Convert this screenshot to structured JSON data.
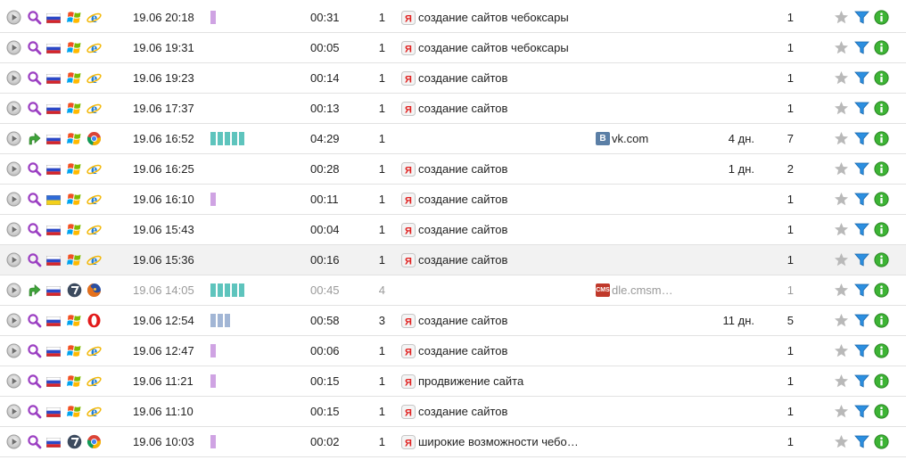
{
  "icons": {
    "play": "play-icon",
    "search_src": "magnifier-icon",
    "link_src": "arrow-link-icon",
    "ru": "flag-ru-icon",
    "ua": "flag-ua-icon",
    "xp": "windows-xp-icon",
    "w7": "windows-7-icon",
    "ie": "ie-icon",
    "chrome": "chrome-icon",
    "firefox": "firefox-icon",
    "opera": "opera-icon",
    "yandex": "yandex-icon",
    "vk": "vk-icon",
    "cms": "cms-icon",
    "star": "star-icon",
    "filter": "filter-icon",
    "info": "info-icon"
  },
  "colors": {
    "bar_violet": "#cfa3e3",
    "bar_teal": "#5ec4bd",
    "bar_blue": "#a2b6d5",
    "yandex_red": "#e0201f"
  },
  "visits": [
    {
      "src": "search",
      "flag": "ru",
      "os": "xp",
      "browser": "ie",
      "time": "19.06 20:18",
      "depth": 1,
      "bar": "violet",
      "duration": "00:31",
      "pageviews": "1",
      "ref": "yandex",
      "keyword": "создание сайтов чебоксары",
      "site": "",
      "days": "",
      "count": "1"
    },
    {
      "src": "search",
      "flag": "ru",
      "os": "xp",
      "browser": "ie",
      "time": "19.06 19:31",
      "depth": 0,
      "bar": "",
      "duration": "00:05",
      "pageviews": "1",
      "ref": "yandex",
      "keyword": "создание сайтов чебоксары",
      "site": "",
      "days": "",
      "count": "1"
    },
    {
      "src": "search",
      "flag": "ru",
      "os": "xp",
      "browser": "ie",
      "time": "19.06 19:23",
      "depth": 0,
      "bar": "",
      "duration": "00:14",
      "pageviews": "1",
      "ref": "yandex",
      "keyword": "создание сайтов",
      "site": "",
      "days": "",
      "count": "1"
    },
    {
      "src": "search",
      "flag": "ru",
      "os": "xp",
      "browser": "ie",
      "time": "19.06 17:37",
      "depth": 0,
      "bar": "",
      "duration": "00:13",
      "pageviews": "1",
      "ref": "yandex",
      "keyword": "создание сайтов",
      "site": "",
      "days": "",
      "count": "1"
    },
    {
      "src": "link",
      "flag": "ru",
      "os": "xp",
      "browser": "chrome",
      "time": "19.06 16:52",
      "depth": 5,
      "bar": "teal",
      "duration": "04:29",
      "pageviews": "1",
      "ref": "",
      "keyword": "",
      "site": "vk.com",
      "site_logo": "vk",
      "site_logo_text": "В",
      "days": "4 дн.",
      "count": "7"
    },
    {
      "src": "search",
      "flag": "ru",
      "os": "xp",
      "browser": "ie",
      "time": "19.06 16:25",
      "depth": 0,
      "bar": "",
      "duration": "00:28",
      "pageviews": "1",
      "ref": "yandex",
      "keyword": "создание сайтов",
      "site": "",
      "days": "1 дн.",
      "count": "2"
    },
    {
      "src": "search",
      "flag": "ua",
      "os": "xp",
      "browser": "ie",
      "time": "19.06 16:10",
      "depth": 1,
      "bar": "violet",
      "duration": "00:11",
      "pageviews": "1",
      "ref": "yandex",
      "keyword": "создание сайтов",
      "site": "",
      "days": "",
      "count": "1"
    },
    {
      "src": "search",
      "flag": "ru",
      "os": "xp",
      "browser": "ie",
      "time": "19.06 15:43",
      "depth": 0,
      "bar": "",
      "duration": "00:04",
      "pageviews": "1",
      "ref": "yandex",
      "keyword": "создание сайтов",
      "site": "",
      "days": "",
      "count": "1"
    },
    {
      "src": "search",
      "flag": "ru",
      "os": "xp",
      "browser": "ie",
      "time": "19.06 15:36",
      "depth": 0,
      "bar": "",
      "duration": "00:16",
      "pageviews": "1",
      "ref": "yandex",
      "keyword": "создание сайтов",
      "site": "",
      "days": "",
      "count": "1",
      "highlight": true
    },
    {
      "src": "link",
      "flag": "ru",
      "os": "w7",
      "browser": "firefox",
      "time": "19.06 14:05",
      "depth": 5,
      "bar": "teal",
      "duration": "00:45",
      "pageviews": "4",
      "ref": "",
      "keyword": "",
      "site": "dle.cmsm…",
      "site_logo": "cms",
      "site_logo_text": "CMS",
      "days": "",
      "count": "1",
      "dim": true
    },
    {
      "src": "search",
      "flag": "ru",
      "os": "xp",
      "browser": "opera",
      "time": "19.06 12:54",
      "depth": 3,
      "bar": "blue",
      "duration": "00:58",
      "pageviews": "3",
      "ref": "yandex",
      "keyword": "создание сайтов",
      "site": "",
      "days": "11 дн.",
      "count": "5"
    },
    {
      "src": "search",
      "flag": "ru",
      "os": "xp",
      "browser": "ie",
      "time": "19.06 12:47",
      "depth": 1,
      "bar": "violet",
      "duration": "00:06",
      "pageviews": "1",
      "ref": "yandex",
      "keyword": "создание сайтов",
      "site": "",
      "days": "",
      "count": "1"
    },
    {
      "src": "search",
      "flag": "ru",
      "os": "xp",
      "browser": "ie",
      "time": "19.06 11:21",
      "depth": 1,
      "bar": "violet",
      "duration": "00:15",
      "pageviews": "1",
      "ref": "yandex",
      "keyword": "продвижение сайта",
      "site": "",
      "days": "",
      "count": "1"
    },
    {
      "src": "search",
      "flag": "ru",
      "os": "xp",
      "browser": "ie",
      "time": "19.06 11:10",
      "depth": 0,
      "bar": "",
      "duration": "00:15",
      "pageviews": "1",
      "ref": "yandex",
      "keyword": "создание сайтов",
      "site": "",
      "days": "",
      "count": "1"
    },
    {
      "src": "search",
      "flag": "ru",
      "os": "w7",
      "browser": "chrome",
      "time": "19.06 10:03",
      "depth": 1,
      "bar": "violet",
      "duration": "00:02",
      "pageviews": "1",
      "ref": "yandex",
      "keyword": "широкие возможности чебо…",
      "site": "",
      "days": "",
      "count": "1"
    }
  ]
}
